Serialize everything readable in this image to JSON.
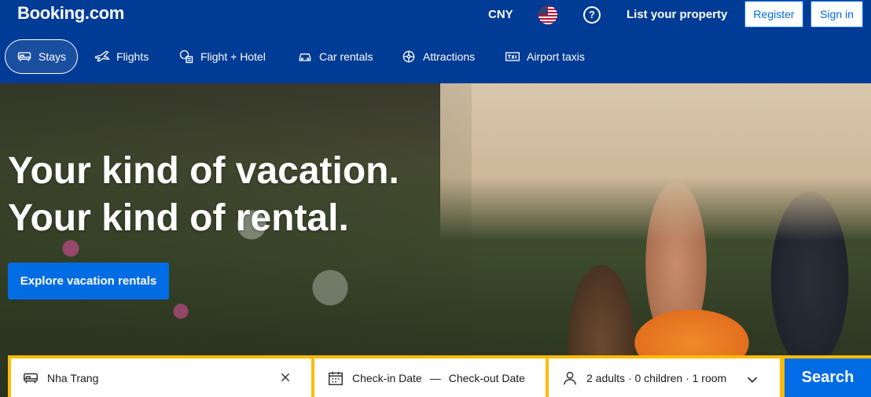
{
  "header": {
    "logo": "Booking.com",
    "currency": "CNY",
    "flag_icon": "us-flag-icon",
    "help_icon": "question-circle-icon",
    "help_glyph": "?",
    "list_property": "List your property",
    "register": "Register",
    "sign_in": "Sign in"
  },
  "nav": {
    "items": [
      {
        "label": "Stays",
        "icon": "bed-icon",
        "active": true
      },
      {
        "label": "Flights",
        "icon": "plane-icon",
        "active": false
      },
      {
        "label": "Flight + Hotel",
        "icon": "plane-hotel-icon",
        "active": false
      },
      {
        "label": "Car rentals",
        "icon": "car-icon",
        "active": false
      },
      {
        "label": "Attractions",
        "icon": "attractions-icon",
        "active": false
      },
      {
        "label": "Airport taxis",
        "icon": "taxi-icon",
        "active": false
      }
    ]
  },
  "hero": {
    "title_line1": "Your kind of vacation.",
    "title_line2": "Your kind of rental.",
    "cta": "Explore vacation rentals"
  },
  "search": {
    "destination_value": "Nha Trang",
    "checkin": "Check-in Date",
    "separator": "—",
    "checkout": "Check-out Date",
    "guests": "2 adults · 0 children · 1 room",
    "button": "Search"
  },
  "colors": {
    "brand_blue": "#003b95",
    "action_blue": "#006ce4",
    "search_yellow": "#febb02"
  }
}
